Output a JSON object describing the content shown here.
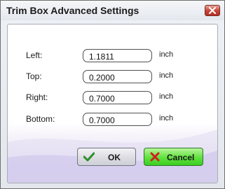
{
  "window": {
    "title": "Trim Box Advanced Settings"
  },
  "fields": [
    {
      "label": "Left:",
      "value": "1.1811",
      "unit": "inch"
    },
    {
      "label": "Top:",
      "value": "0.2000",
      "unit": "inch"
    },
    {
      "label": "Right:",
      "value": "0.7000",
      "unit": "inch"
    },
    {
      "label": "Bottom:",
      "value": "0.7000",
      "unit": "inch"
    }
  ],
  "buttons": {
    "ok_label": "OK",
    "cancel_label": "Cancel"
  },
  "icons": {
    "close": "close-icon",
    "ok": "checkmark-icon",
    "cancel": "x-mark-icon"
  },
  "colors": {
    "close_button": "#c9473a",
    "cancel_button": "#5fe23d",
    "ok_check": "#2f8f2f",
    "cancel_x": "#d02020"
  }
}
